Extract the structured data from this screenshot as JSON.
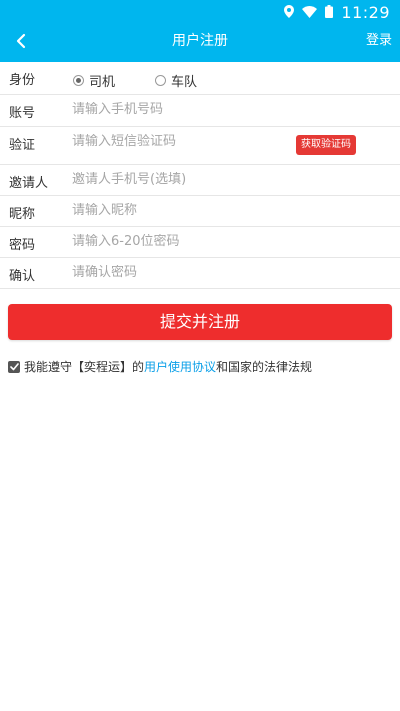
{
  "status_bar": {
    "time": "11:29"
  },
  "app_bar": {
    "title": "用户注册",
    "right_action": "登录"
  },
  "form": {
    "identity": {
      "label": "身份",
      "options": [
        "司机",
        "车队"
      ],
      "selected": "司机"
    },
    "account": {
      "label": "账号",
      "placeholder": "请输入手机号码"
    },
    "verify": {
      "label": "验证",
      "placeholder": "请输入短信验证码",
      "button": "获取验证码"
    },
    "inviter": {
      "label": "邀请人",
      "placeholder": "邀请人手机号(选填)"
    },
    "nickname": {
      "label": "昵称",
      "placeholder": "请输入昵称"
    },
    "password": {
      "label": "密码",
      "placeholder": "请输入6-20位密码"
    },
    "confirm": {
      "label": "确认",
      "placeholder": "请确认密码"
    }
  },
  "submit": {
    "label": "提交并注册"
  },
  "agreement": {
    "checked": true,
    "prefix": "我能遵守【奕程运】的",
    "link": "用户使用协议",
    "suffix": "和国家的法律法规"
  },
  "colors": {
    "primary": "#00b6ee",
    "submit": "#ee2d2d",
    "code_button": "#e53935",
    "link": "#0a9fe8"
  },
  "icons": [
    "location-icon",
    "wifi-icon",
    "battery-icon",
    "back-arrow-icon",
    "checkbox-checked-icon"
  ]
}
